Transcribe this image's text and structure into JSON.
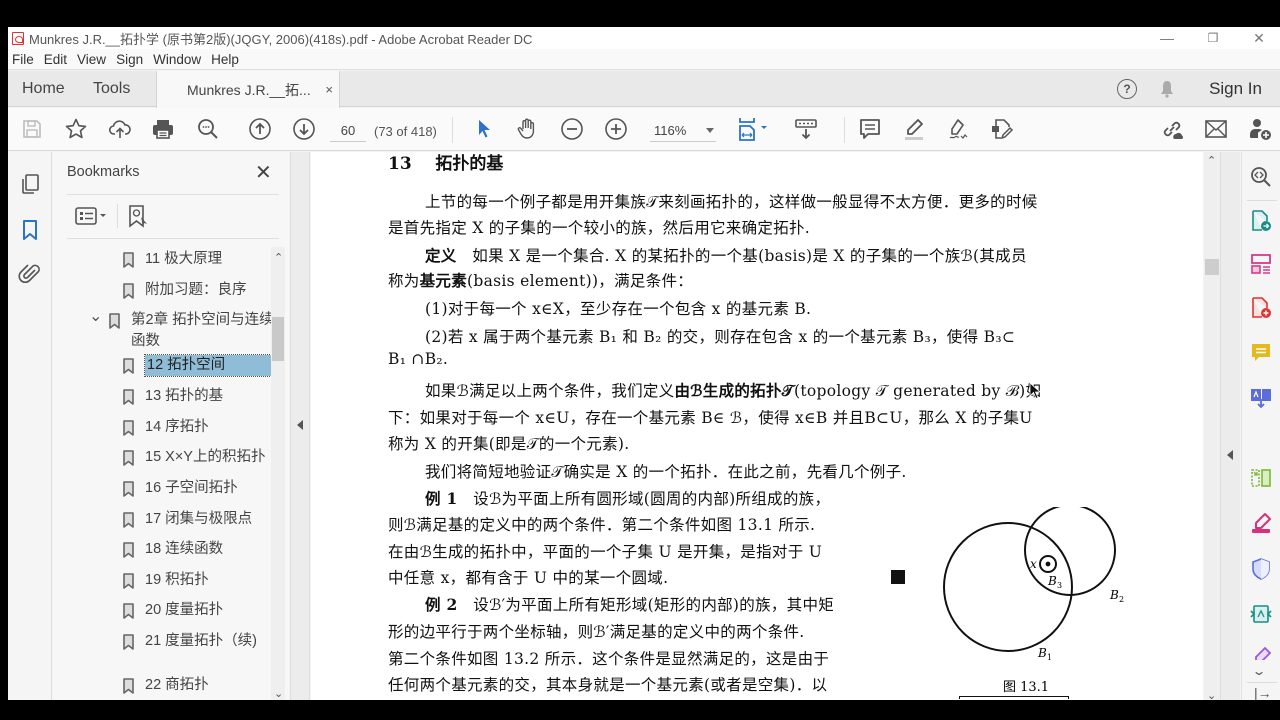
{
  "window": {
    "title": "Munkres J.R.__拓扑学 (原书第2版)(JQGY, 2006)(418s).pdf - Adobe Acrobat Reader DC",
    "controls": {
      "minimize": "—",
      "restore": "❐",
      "close": "✕"
    }
  },
  "menu": [
    "File",
    "Edit",
    "View",
    "Sign",
    "Window",
    "Help"
  ],
  "tabs": {
    "home": "Home",
    "tools": "Tools",
    "document": "Munkres J.R.__拓...",
    "close": "×",
    "help": "?",
    "sign_in": "Sign In"
  },
  "toolbar": {
    "page_number": "60",
    "page_count": "(73 of 418)",
    "zoom": "116%",
    "icons": [
      "save-icon",
      "bookmark-star-icon",
      "upload-cloud-icon",
      "print-icon",
      "search-zoom-icon",
      "page-up-icon",
      "page-down-icon",
      "select-pointer-icon",
      "hand-icon",
      "zoom-out-icon",
      "zoom-in-icon",
      "fit-page-icon",
      "scroll-mode-icon",
      "comment-icon",
      "highlight-icon",
      "sign-icon",
      "edit-pdf-icon",
      "share-link-icon",
      "email-icon",
      "add-user-icon"
    ]
  },
  "bookmarks": {
    "title": "Bookmarks",
    "close": "✕",
    "items": [
      {
        "label": "11  极大原理",
        "selected": false
      },
      {
        "label": "附加习题：良序",
        "selected": false
      },
      {
        "label": "第2章  拓扑空间与连续函数",
        "selected": false,
        "expanded": true
      },
      {
        "label": "12  拓扑空间",
        "selected": true
      },
      {
        "label": "13  拓扑的基",
        "selected": false
      },
      {
        "label": "14  序拓扑",
        "selected": false
      },
      {
        "label": "15  X×Y上的积拓扑",
        "selected": false
      },
      {
        "label": "16  子空间拓扑",
        "selected": false
      },
      {
        "label": "17  闭集与极限点",
        "selected": false
      },
      {
        "label": "18  连续函数",
        "selected": false
      },
      {
        "label": "19  积拓扑",
        "selected": false
      },
      {
        "label": "20  度量拓扑",
        "selected": false
      },
      {
        "label": "21  度量拓扑（续)",
        "selected": false
      },
      {
        "label": "22  商拓扑",
        "selected": false
      }
    ]
  },
  "document": {
    "heading_num": "13",
    "heading": "拓扑的基",
    "lines": [
      "上节的每一个例子都是用开集族𝒯来刻画拓扑的，这样做一般显得不太方便．更多的时候",
      "是首先指定 X 的子集的一个较小的族，然后用它来确定拓扑.",
      "如果 X 是一个集合. X 的某拓扑的一个基(basis)是 X 的子集的一个族ℬ(其成员",
      "(basis element))，满足条件：",
      "(1)对于每一个 x∈X，至少存在一个包含 x 的基元素 B.",
      "(2)若 x 属于两个基元素 B₁ 和 B₂ 的交，则存在包含 x 的一个基元素 B₃，使得 B₃⊂",
      "B₁ ∩B₂.",
      "如果ℬ满足以上两个条件，我们定义",
      "(topology 𝒯 generated by ℬ)如",
      "下：如果对于每一个 x∈U，存在一个基元素 B∈ ℬ，使得 x∈B 并且B⊂U，那么 X 的子集U",
      "称为 X 的开集(即是𝒯的一个元素).",
      "我们将简短地验证𝒯确实是 X 的一个拓扑．在此之前，先看几个例子.",
      "设ℬ为平面上所有圆形域(圆周的内部)所组成的族，",
      "则ℬ满足基的定义中的两个条件．第二个条件如图 13.1 所示.",
      "在由ℬ生成的拓扑中，平面的一个子集 U 是开集，是指对于 U",
      "中任意 x，都有含于 U 中的某一个圆域.",
      "设ℬ′为平面上所有矩形域(矩形的内部)的族，其中矩",
      "形的边平行于两个坐标轴，则ℬ′满足基的定义中的两个条件.",
      "第二个条件如图 13.2 所示．这个条件是显然满足的，这是由于",
      "任何两个基元素的交，其本身就是一个基元素(或者是空集)．以"
    ],
    "bold": {
      "definition": "定义",
      "called": "称为",
      "basis_element": "基元素",
      "generated": "由ℬ生成的拓扑𝒯",
      "example1": "例 1",
      "example2": "例 2"
    },
    "figure": {
      "x": "x",
      "b1": "B",
      "b2": "B",
      "b3": "B",
      "s1": "1",
      "s2": "2",
      "s3": "3",
      "caption": "图    13.1"
    }
  }
}
